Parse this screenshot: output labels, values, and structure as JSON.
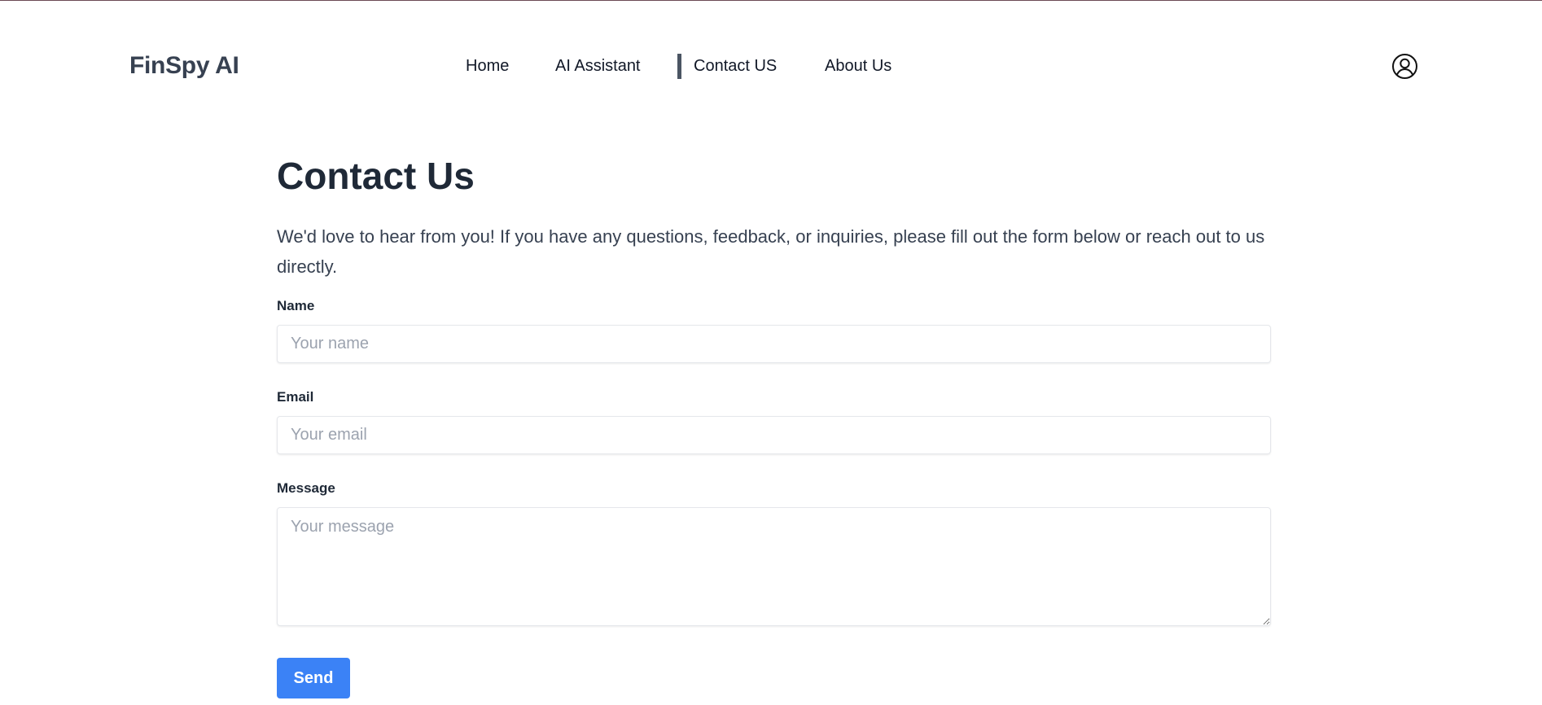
{
  "brand": "FinSpy AI",
  "nav": {
    "home": "Home",
    "ai_assistant": "AI Assistant",
    "contact": "Contact US",
    "about": "About Us",
    "active": "contact"
  },
  "user_icon": "user-circle-icon",
  "page": {
    "title": "Contact Us",
    "intro": "We'd love to hear from you! If you have any questions, feedback, or inquiries, please fill out the form below or reach out to us directly."
  },
  "form": {
    "name_label": "Name",
    "name_placeholder": "Your name",
    "name_value": "",
    "email_label": "Email",
    "email_placeholder": "Your email",
    "email_value": "",
    "message_label": "Message",
    "message_placeholder": "Your message",
    "message_value": "",
    "send_label": "Send"
  },
  "colors": {
    "accent": "#3b82f6",
    "active_indicator": "#4b5563",
    "heading": "#1f2937",
    "placeholder": "#9ca3af"
  }
}
